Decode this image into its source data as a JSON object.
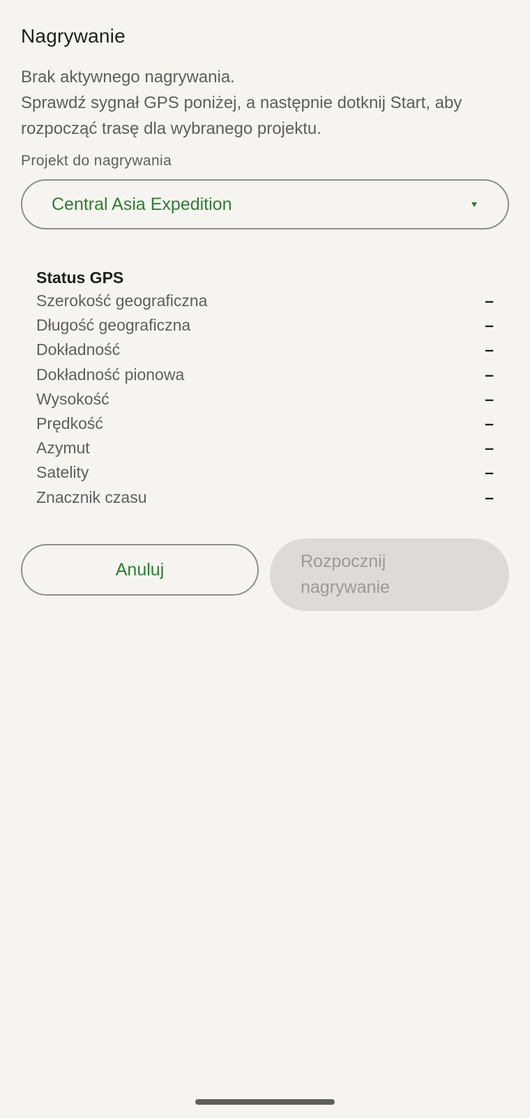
{
  "header": {
    "title": "Nagrywanie"
  },
  "description": {
    "line1": "Brak aktywnego nagrywania.",
    "line2": "Sprawdź sygnał GPS poniżej, a następnie dotknij Start, aby rozpocząć trasę dla wybranego projektu."
  },
  "project": {
    "label": "Projekt do nagrywania",
    "selected": "Central Asia Expedition"
  },
  "gps": {
    "title": "Status GPS",
    "rows": [
      {
        "label": "Szerokość geograficzna",
        "value": "–"
      },
      {
        "label": "Długość geograficzna",
        "value": "–"
      },
      {
        "label": "Dokładność",
        "value": "–"
      },
      {
        "label": "Dokładność pionowa",
        "value": "–"
      },
      {
        "label": "Wysokość",
        "value": "–"
      },
      {
        "label": "Prędkość",
        "value": "–"
      },
      {
        "label": "Azymut",
        "value": "–"
      },
      {
        "label": "Satelity",
        "value": "–"
      },
      {
        "label": "Znacznik czasu",
        "value": "–"
      }
    ]
  },
  "actions": {
    "cancel_label": "Anuluj",
    "start_label": "Rozpocznij nagrywanie"
  },
  "colors": {
    "accent": "#2e7d32",
    "background": "#f5f4f1",
    "disabled_bg": "#dcdbd9"
  }
}
